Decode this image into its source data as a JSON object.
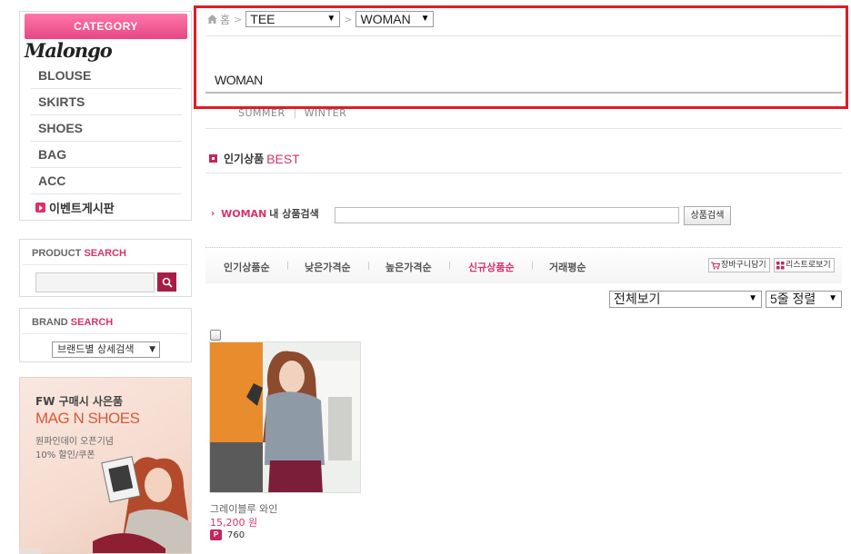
{
  "sidebar": {
    "category_header": "CATEGORY",
    "brand_logo": "Malongo",
    "categories": [
      "BLOUSE",
      "SKIRTS",
      "SHOES",
      "BAG",
      "ACC"
    ],
    "event_board": "이벤트게시판",
    "product_search": {
      "title_a": "PRODUCT",
      "title_b": "SEARCH",
      "input_value": ""
    },
    "brand_search": {
      "title_a": "BRAND",
      "title_b": "SEARCH",
      "select_value": "브랜드별 상세검색"
    },
    "banner": {
      "line1": "FW 구매시 사은품",
      "line2": "MAG N SHOES",
      "line3": "원파인데이 오픈기념",
      "line4": "10% 할인/쿠폰"
    }
  },
  "breadcrumb": {
    "home": "홈",
    "select1": "TEE",
    "select2": "WOMAN"
  },
  "page_title": "WOMAN",
  "subcategories": [
    "SUMMER",
    "WINTER"
  ],
  "best": {
    "label": "인기상품",
    "highlight": "BEST"
  },
  "in_search": {
    "category": "WOMAN",
    "label": "내 상품검색",
    "button": "상품검색",
    "input_value": ""
  },
  "sort": {
    "items": [
      "인기상품순",
      "낮은가격순",
      "높은가격순",
      "신규상품순",
      "거래평순"
    ],
    "active_index": 3,
    "cart_button": "장바구니담기",
    "list_button": "리스트로보기"
  },
  "filters": {
    "view_select": "전체보기",
    "layout_select": "5줄 정렬"
  },
  "products": [
    {
      "name": "그레이블루 와인",
      "price": "15,200 원",
      "point_badge": "P",
      "points": "760"
    }
  ],
  "colors": {
    "accent": "#d8326d",
    "category_header": "#e64785",
    "highlight_box": "#e01b24"
  }
}
